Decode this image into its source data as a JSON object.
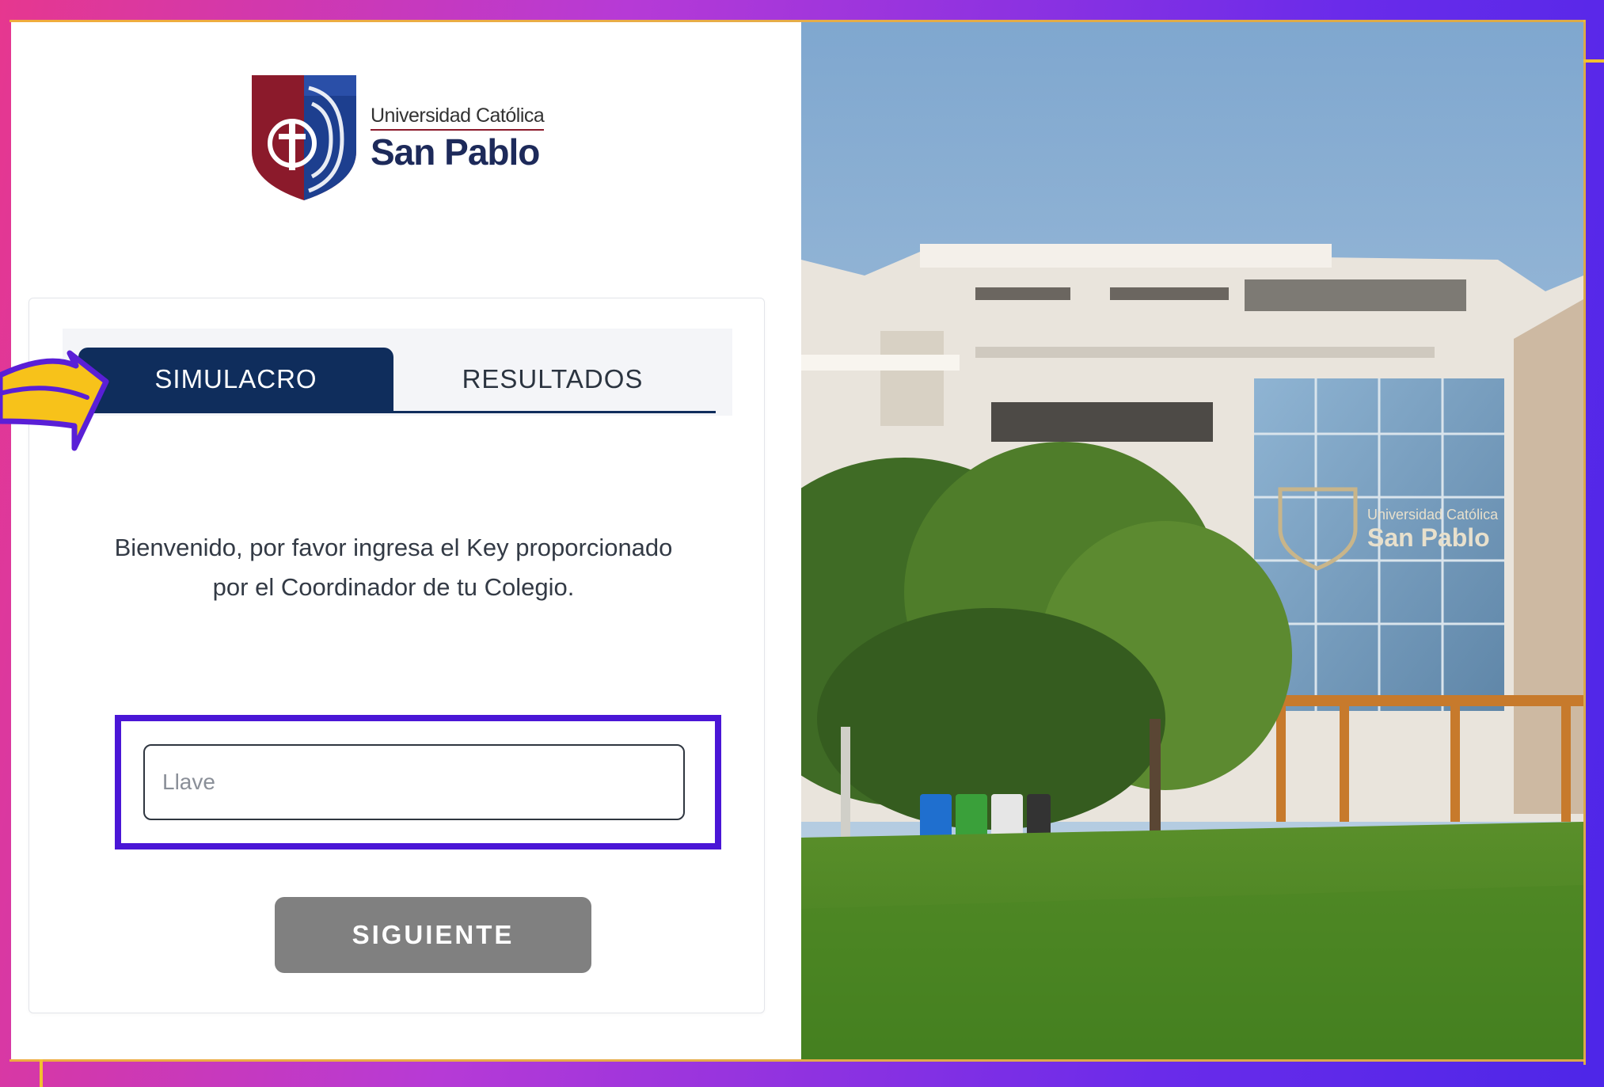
{
  "brand": {
    "small_text": "Universidad Católica",
    "big_text": "San Pablo"
  },
  "tabs": [
    {
      "label": "SIMULACRO",
      "active": true
    },
    {
      "label": "RESULTADOS",
      "active": false
    }
  ],
  "welcome": {
    "message": "Bienvenido, por favor ingresa el Key proporcionado por el Coordinador de tu Colegio."
  },
  "key_input": {
    "placeholder": "Llave",
    "value": ""
  },
  "next_button": {
    "label": "SIGUIENTE"
  },
  "photo": {
    "sign_small": "Universidad Católica",
    "sign_big": "San Pablo"
  },
  "colors": {
    "tab_active": "#0f2d5c",
    "highlight": "#4a16d6",
    "arrow": "#f7c21a",
    "button": "#808080"
  }
}
